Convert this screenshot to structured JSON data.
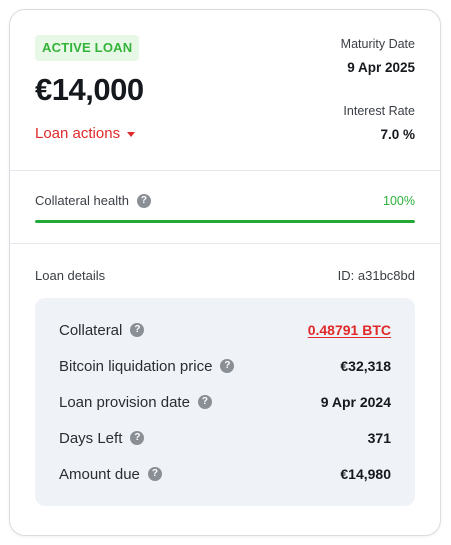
{
  "loan": {
    "status_badge": "ACTIVE LOAN",
    "amount": "€14,000",
    "actions_label": "Loan actions",
    "maturity_label": "Maturity Date",
    "maturity_value": "9 Apr 2025",
    "interest_label": "Interest Rate",
    "interest_value": "7.0 %"
  },
  "health": {
    "label": "Collateral health",
    "percent_text": "100%",
    "level_fraction": 1.0
  },
  "details": {
    "label": "Loan details",
    "id_text": "ID: a31bc8bd",
    "rows": [
      {
        "label": "Collateral",
        "value": "0.48791 BTC"
      },
      {
        "label": "Bitcoin liquidation price",
        "value": "€32,318"
      },
      {
        "label": "Loan provision date",
        "value": "9 Apr 2024"
      },
      {
        "label": "Days Left",
        "value": "371"
      },
      {
        "label": "Amount due",
        "value": "€14,980"
      }
    ]
  },
  "icons": {
    "help": "question-circle-icon",
    "dropdown": "caret-down-icon"
  },
  "colors": {
    "accent_red": "#e02a2a",
    "health_green": "#22a836",
    "badge_green": "#33b33a",
    "badge_bg": "#e8f8e6",
    "panel_bg": "#eff2f6"
  }
}
